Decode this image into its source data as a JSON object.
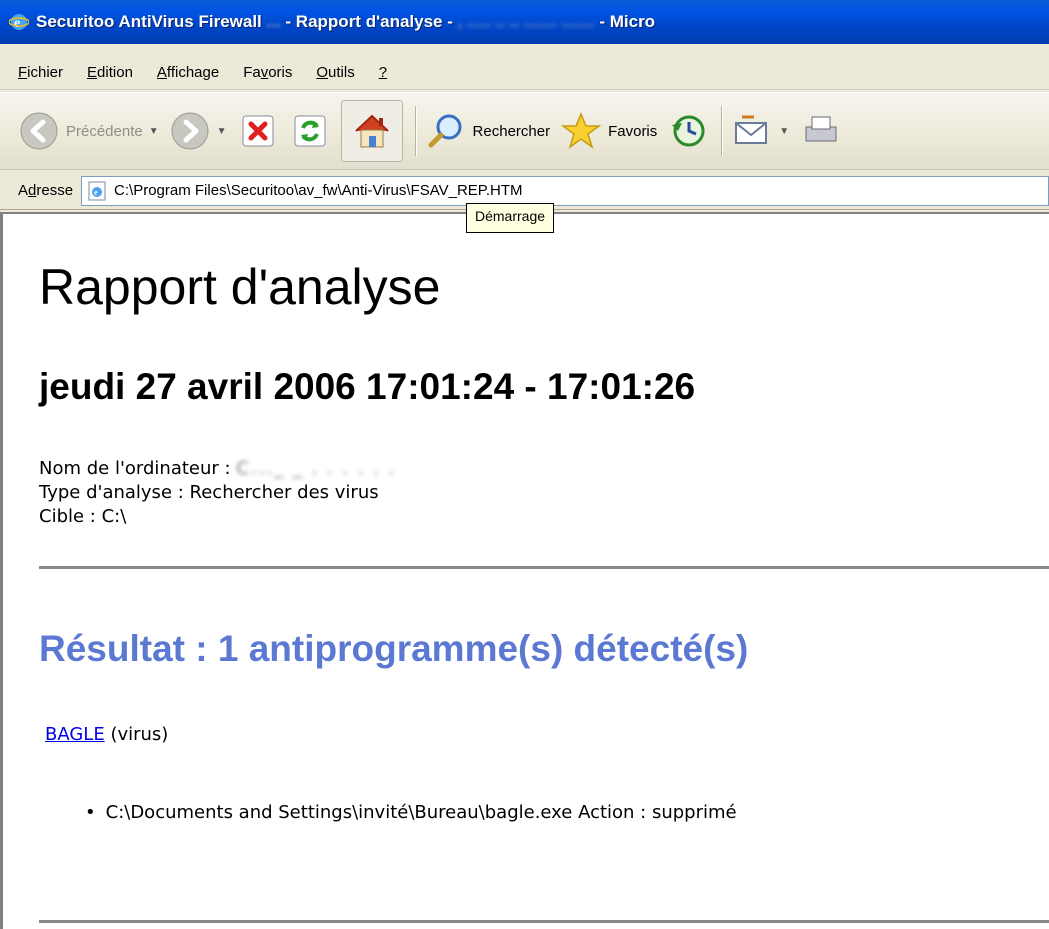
{
  "window": {
    "title": "Securitoo AntiVirus Firewall",
    "title_blurred": "...",
    "title_tab": "- Rapport d'analyse -",
    "title_suffix": "- Micro"
  },
  "menu": {
    "items": [
      {
        "key": "F",
        "rest": "ichier"
      },
      {
        "key": "E",
        "rest": "dition"
      },
      {
        "key": "A",
        "rest": "ffichage"
      },
      {
        "pre": "Fa",
        "key": "v",
        "rest": "oris"
      },
      {
        "key": "O",
        "rest": "utils"
      },
      {
        "key": "?",
        "rest": ""
      }
    ]
  },
  "toolbar": {
    "back_label": "Précédente",
    "search_label": "Rechercher",
    "favorites_label": "Favoris",
    "icons": [
      "back-icon",
      "forward-icon",
      "stop-icon",
      "refresh-icon",
      "home-icon",
      "search-icon",
      "favorites-star-icon",
      "history-icon",
      "mail-icon",
      "print-icon"
    ]
  },
  "address": {
    "label_pre": "A",
    "label_key": "d",
    "label_rest": "resse",
    "url": "C:\\Program Files\\Securitoo\\av_fw\\Anti-Virus\\FSAV_REP.HTM"
  },
  "tooltip": {
    "text": "Démarrage"
  },
  "report": {
    "title": "Rapport d'analyse",
    "date": "jeudi 27 avril 2006 17:01:24 - 17:01:26",
    "computer_label": "Nom de l'ordinateur :",
    "computer_value": "C...",
    "scan_type": "Type d'analyse : Rechercher des virus",
    "target": "Cible : C:\\",
    "result": "Résultat : 1 antiprogramme(s) détecté(s)",
    "threat_name": "BAGLE",
    "threat_type": "(virus)",
    "threat_path": "C:\\Documents and Settings\\invité\\Bureau\\bagle.exe Action : supprimé"
  },
  "colors": {
    "titlebar": "#0054e3",
    "result_heading": "#5b79d3",
    "link": "#0000ee"
  }
}
